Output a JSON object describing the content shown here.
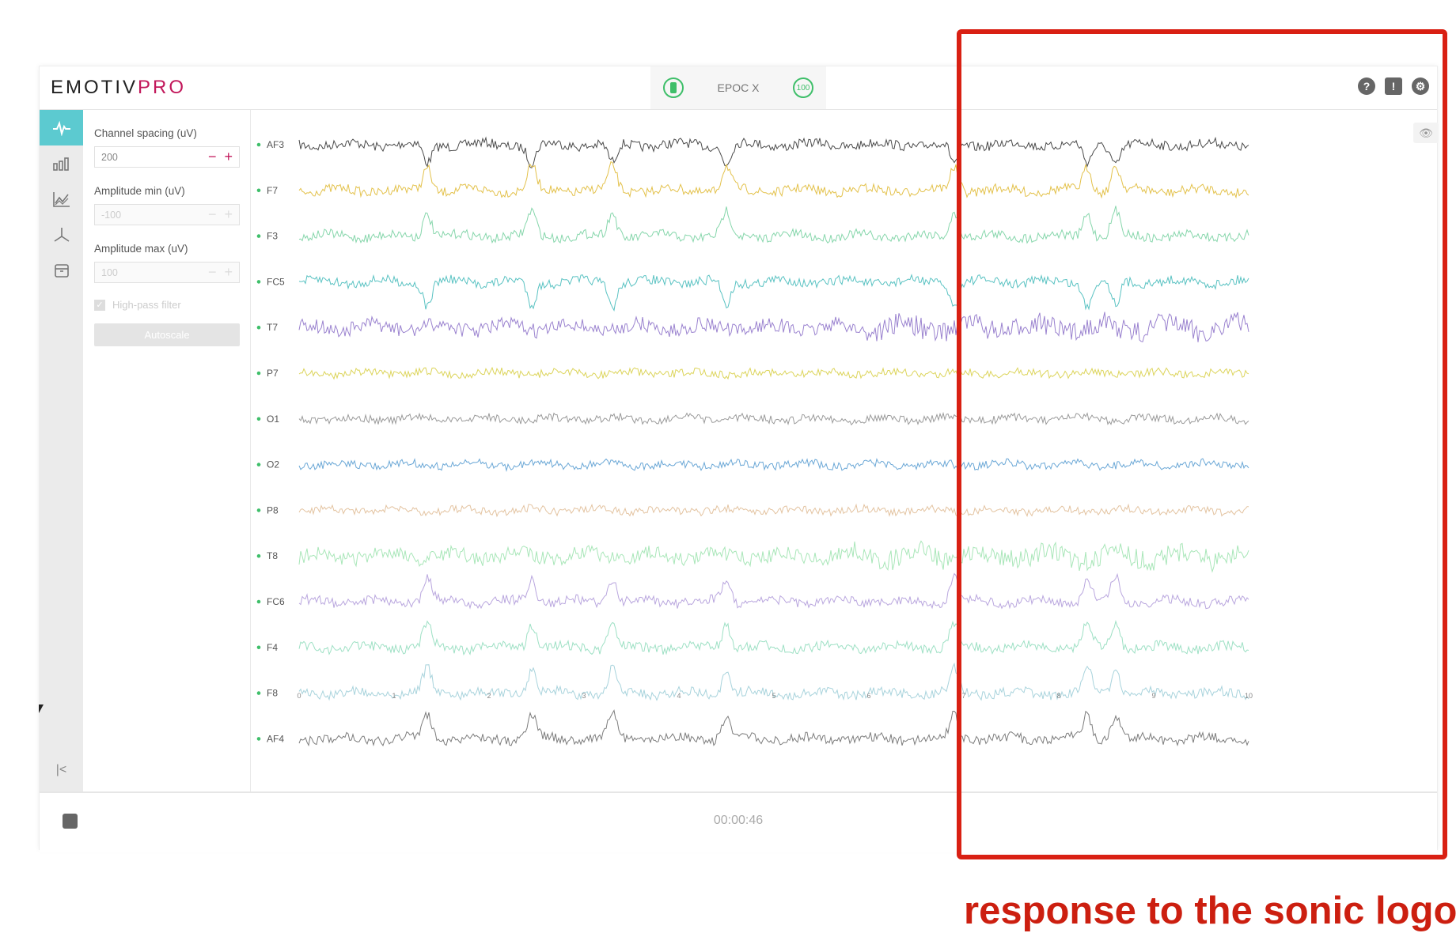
{
  "app": {
    "logo_main": "EMOTIV",
    "logo_pro": "PRO",
    "device_name": "EPOC X",
    "signal_value": "100",
    "header_icons": [
      "help-icon",
      "feedback-icon",
      "gear-icon"
    ]
  },
  "sidebar": {
    "items": [
      "waveform-icon",
      "bar-chart-icon",
      "line-chart-icon",
      "axes-icon",
      "archive-icon"
    ],
    "collapse_icon": "collapse-left-icon",
    "collapse_label": "|<"
  },
  "settings": {
    "channel_spacing_label": "Channel spacing (uV)",
    "channel_spacing_value": "200",
    "amplitude_min_label": "Amplitude min (uV)",
    "amplitude_min_value": "-100",
    "amplitude_max_label": "Amplitude max (uV)",
    "amplitude_max_value": "100",
    "high_pass_label": "High-pass filter",
    "autoscale_label": "Autoscale"
  },
  "chart_data": {
    "type": "line",
    "x_ticks": [
      "0",
      "1",
      "2",
      "3",
      "4",
      "5",
      "6",
      "7",
      "8",
      "9",
      "10"
    ],
    "xlim": [
      0,
      10
    ],
    "channels": [
      {
        "name": "AF3",
        "color": "#4a4a4a"
      },
      {
        "name": "F7",
        "color": "#e3c14a"
      },
      {
        "name": "F3",
        "color": "#86d6ab"
      },
      {
        "name": "FC5",
        "color": "#59c2c2"
      },
      {
        "name": "T7",
        "color": "#9a82cf"
      },
      {
        "name": "P7",
        "color": "#dcd45a"
      },
      {
        "name": "O1",
        "color": "#9a9a9a"
      },
      {
        "name": "O2",
        "color": "#6aa7d6"
      },
      {
        "name": "P8",
        "color": "#e3c3a0"
      },
      {
        "name": "T8",
        "color": "#a8e6b8"
      },
      {
        "name": "FC6",
        "color": "#b9a6de"
      },
      {
        "name": "F4",
        "color": "#9de0c4"
      },
      {
        "name": "F8",
        "color": "#a8d3dc"
      },
      {
        "name": "AF4",
        "color": "#7c7c7c"
      }
    ],
    "channel_dot_color": "#3fbf6a",
    "highlight_window": [
      5.8,
      10
    ]
  },
  "footer": {
    "timer": "00:00:46"
  },
  "annotation": {
    "text": "response to the sonic logo",
    "color": "#cc1f10"
  }
}
